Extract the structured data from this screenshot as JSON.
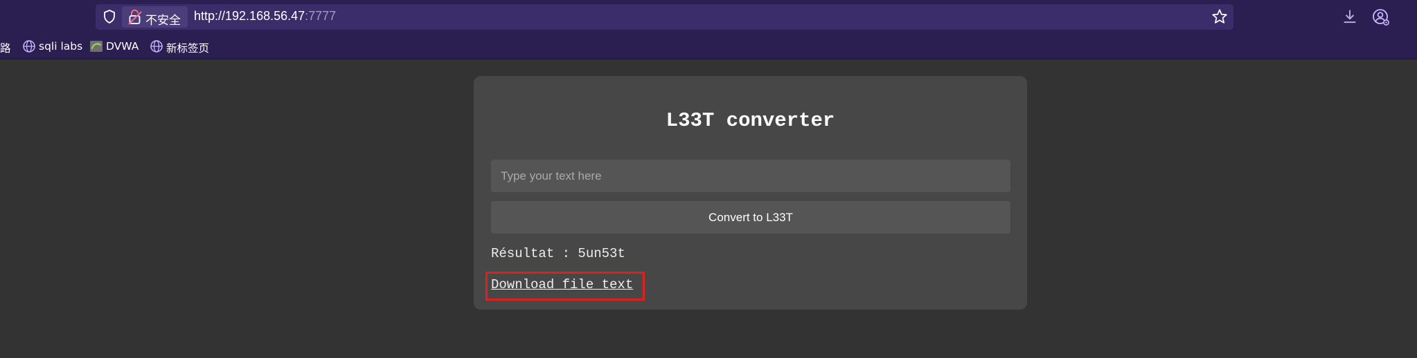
{
  "browser": {
    "insecure_label": "不安全",
    "url_host": "http://192.168.56.47",
    "url_port": ":7777",
    "icons": {
      "shield": "shield-icon",
      "lock": "broken-lock-icon",
      "star": "star-icon",
      "download": "download-icon",
      "account": "account-icon"
    },
    "accent_color": "#2b1f52"
  },
  "bookmarks": {
    "truncated_label": "路",
    "items": [
      {
        "label": "sqli labs",
        "icon": "globe-icon"
      },
      {
        "label": "DVWA",
        "icon": "dvwa-favicon"
      },
      {
        "label": "新标签页",
        "icon": "globe-icon"
      }
    ]
  },
  "page": {
    "title": "L33T converter",
    "input_placeholder": "Type your text here",
    "input_value": "",
    "convert_label": "Convert to L33T",
    "result_text": "Résultat : 5un53t",
    "download_label": "Download file text",
    "highlight_color": "#e0201e"
  }
}
